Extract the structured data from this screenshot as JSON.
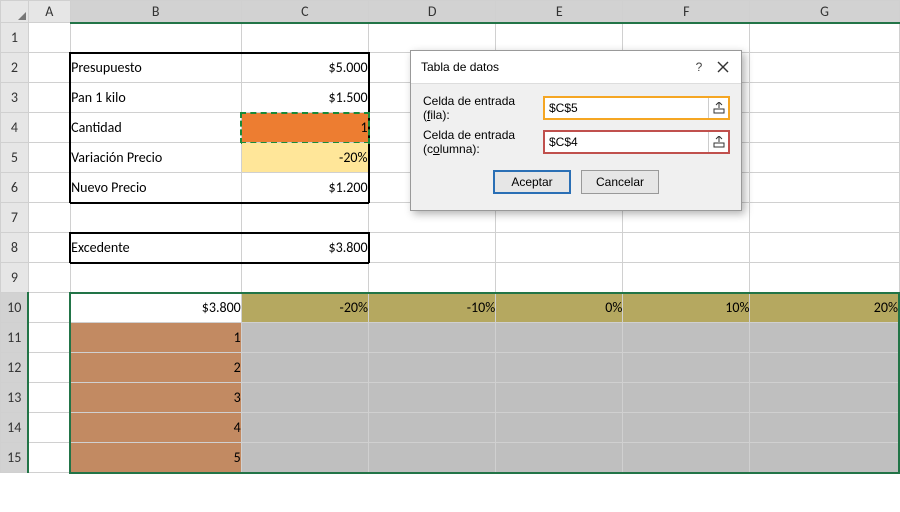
{
  "columns": [
    "A",
    "B",
    "C",
    "D",
    "E",
    "F",
    "G"
  ],
  "rows": [
    "1",
    "2",
    "3",
    "4",
    "5",
    "6",
    "7",
    "8",
    "9",
    "10",
    "11",
    "12",
    "13",
    "14",
    "15"
  ],
  "labels": {
    "presupuesto": "Presupuesto",
    "pan": "Pan 1 kilo",
    "cantidad": "Cantidad",
    "variacion": "Variación Precio",
    "nuevo": "Nuevo Precio",
    "excedente": "Excedente"
  },
  "values": {
    "presupuesto": "$5.000",
    "pan": "$1.500",
    "cantidad": "1",
    "variacion": "-20%",
    "nuevo": "$1.200",
    "excedente": "$3.800"
  },
  "dataTable": {
    "cornerValue": "$3.800",
    "colPercents": [
      "-20%",
      "-10%",
      "0%",
      "10%",
      "20%"
    ],
    "rowCounts": [
      "1",
      "2",
      "3",
      "4",
      "5"
    ]
  },
  "dialog": {
    "title": "Tabla de datos",
    "rowLabelPrefix": "Celda de entrada (",
    "rowLabelU": "f",
    "rowLabelSuffix": "ila):",
    "colLabelPrefix": "Celda de entrada (c",
    "colLabelU": "o",
    "colLabelSuffix": "lumna):",
    "rowInput": "$C$5",
    "colInput": "$C$4",
    "ok": "Aceptar",
    "cancel": "Cancelar",
    "help": "?",
    "close": "×"
  }
}
